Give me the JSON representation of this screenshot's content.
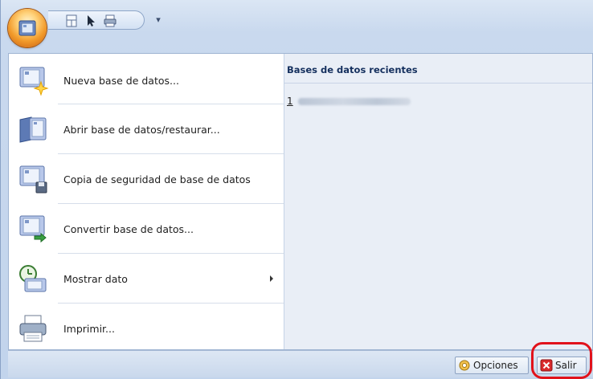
{
  "quick_access_toolbar": {
    "buttons": [
      "layout-icon",
      "pointer-icon",
      "print-icon"
    ],
    "customize_glyph": "▾"
  },
  "menu": {
    "items": [
      {
        "label": "Nueva base de datos...",
        "icon": "new-database-icon"
      },
      {
        "label": "Abrir base de datos/restaurar...",
        "icon": "open-database-icon"
      },
      {
        "label": "Copia de seguridad de base de datos",
        "icon": "backup-database-icon"
      },
      {
        "label": "Convertir base de datos...",
        "icon": "convert-database-icon"
      },
      {
        "label": "Mostrar dato",
        "icon": "show-data-icon",
        "has_submenu": true
      },
      {
        "label": "Imprimir...",
        "icon": "printer-icon"
      }
    ]
  },
  "recent": {
    "header": "Bases de datos recientes",
    "items": [
      {
        "number": "1"
      }
    ]
  },
  "bottom": {
    "options_label": "Opciones",
    "exit_label": "Salir"
  },
  "colors": {
    "highlight": "#e1121b",
    "accent": "#15305e"
  }
}
